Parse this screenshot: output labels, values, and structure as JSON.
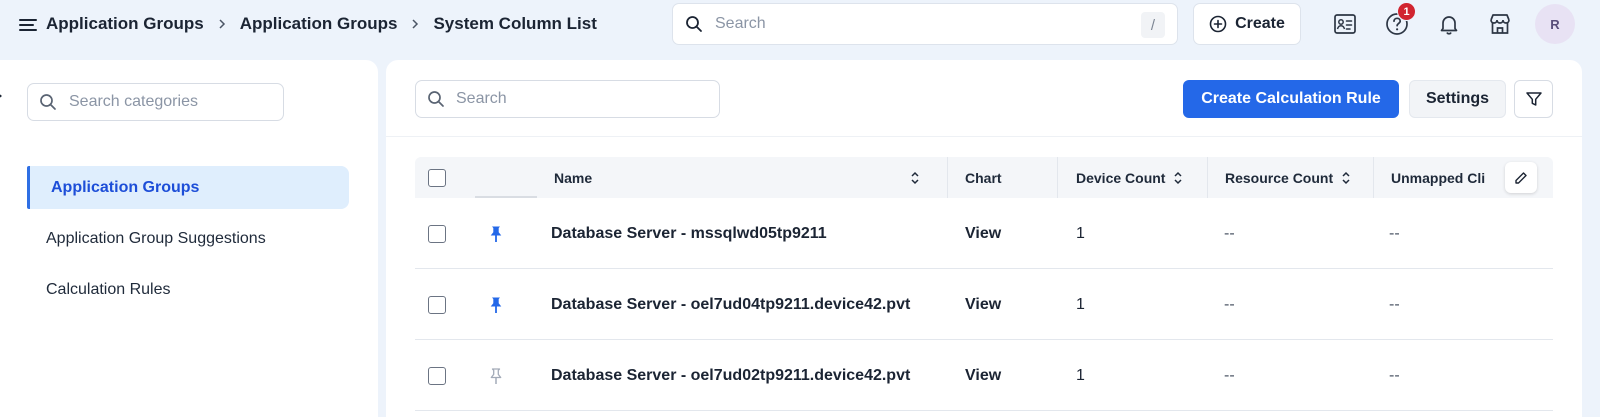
{
  "breadcrumb": [
    "Application Groups",
    "Application Groups"
  ],
  "breadcrumb_current": "System Column List",
  "global_search": {
    "placeholder": "Search",
    "shortcut": "/"
  },
  "create_label": "Create",
  "help_badge": "1",
  "avatar_initial": "R",
  "sidebar": {
    "search_placeholder": "Search categories",
    "items": [
      {
        "label": "Application Groups",
        "active": true
      },
      {
        "label": "Application Group Suggestions",
        "active": false
      },
      {
        "label": "Calculation Rules",
        "active": false
      }
    ]
  },
  "toolbar": {
    "search_placeholder": "Search",
    "primary_label": "Create Calculation Rule",
    "settings_label": "Settings"
  },
  "table": {
    "columns": [
      "Name",
      "Chart",
      "Device Count",
      "Resource Count",
      "Unmapped Cli"
    ],
    "rows": [
      {
        "pinned": true,
        "name": "Database Server - mssqlwd05tp9211",
        "chart": "View",
        "device_count": "1",
        "resource_count": "--",
        "unmapped": "--"
      },
      {
        "pinned": true,
        "name": "Database Server - oel7ud04tp9211.device42.pvt",
        "chart": "View",
        "device_count": "1",
        "resource_count": "--",
        "unmapped": "--"
      },
      {
        "pinned": false,
        "name": "Database Server - oel7ud02tp9211.device42.pvt",
        "chart": "View",
        "device_count": "1",
        "resource_count": "--",
        "unmapped": "--"
      }
    ]
  },
  "colors": {
    "primary": "#2468e8",
    "active_nav_bg": "#dfeefd",
    "pin_active": "#2468e8",
    "pin_inactive": "#a3abb8",
    "badge": "#d1242f"
  }
}
